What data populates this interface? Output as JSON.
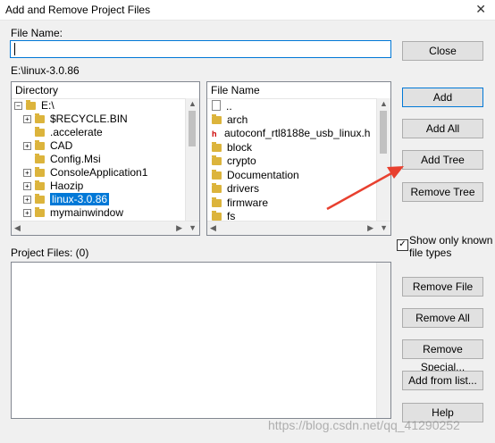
{
  "window": {
    "title": "Add and Remove Project Files",
    "close_glyph": "✕"
  },
  "file_name": {
    "label": "File Name:",
    "value": ""
  },
  "current_path": "E:\\linux-3.0.86",
  "directory": {
    "header": "Directory",
    "root": "E:\\",
    "items": [
      {
        "label": "$RECYCLE.BIN",
        "expandable": true,
        "selected": false
      },
      {
        "label": ".accelerate",
        "expandable": false,
        "selected": false
      },
      {
        "label": "CAD",
        "expandable": true,
        "selected": false
      },
      {
        "label": "Config.Msi",
        "expandable": false,
        "selected": false
      },
      {
        "label": "ConsoleApplication1",
        "expandable": true,
        "selected": false
      },
      {
        "label": "Haozip",
        "expandable": true,
        "selected": false
      },
      {
        "label": "linux-3.0.86",
        "expandable": true,
        "selected": true
      },
      {
        "label": "mymainwindow",
        "expandable": true,
        "selected": false
      }
    ]
  },
  "file_list": {
    "header": "File Name",
    "items": [
      {
        "label": "..",
        "icon": "file-icon"
      },
      {
        "label": "arch",
        "icon": "folder-icon"
      },
      {
        "label": "autoconf_rtl8188e_usb_linux.h",
        "icon": "header-file-icon",
        "icon_glyph": "h"
      },
      {
        "label": "block",
        "icon": "folder-icon"
      },
      {
        "label": "crypto",
        "icon": "folder-icon"
      },
      {
        "label": "Documentation",
        "icon": "folder-icon"
      },
      {
        "label": "drivers",
        "icon": "folder-icon"
      },
      {
        "label": "firmware",
        "icon": "folder-icon"
      },
      {
        "label": "fs",
        "icon": "folder-icon"
      }
    ]
  },
  "buttons": {
    "close": "Close",
    "add": "Add",
    "add_all": "Add All",
    "add_tree": "Add Tree",
    "remove_tree": "Remove Tree",
    "remove_file": "Remove File",
    "remove_all": "Remove All",
    "remove_special": "Remove Special...",
    "add_from_list": "Add from list...",
    "help": "Help"
  },
  "show_known": {
    "label_line1": "Show only known",
    "label_line2": "file types",
    "checked": true,
    "check_glyph": "✓"
  },
  "project_files": {
    "label": "Project Files: (0)"
  },
  "annotation": {
    "arrow_color": "#e8402f"
  },
  "watermark": "https://blog.csdn.net/qq_41290252"
}
